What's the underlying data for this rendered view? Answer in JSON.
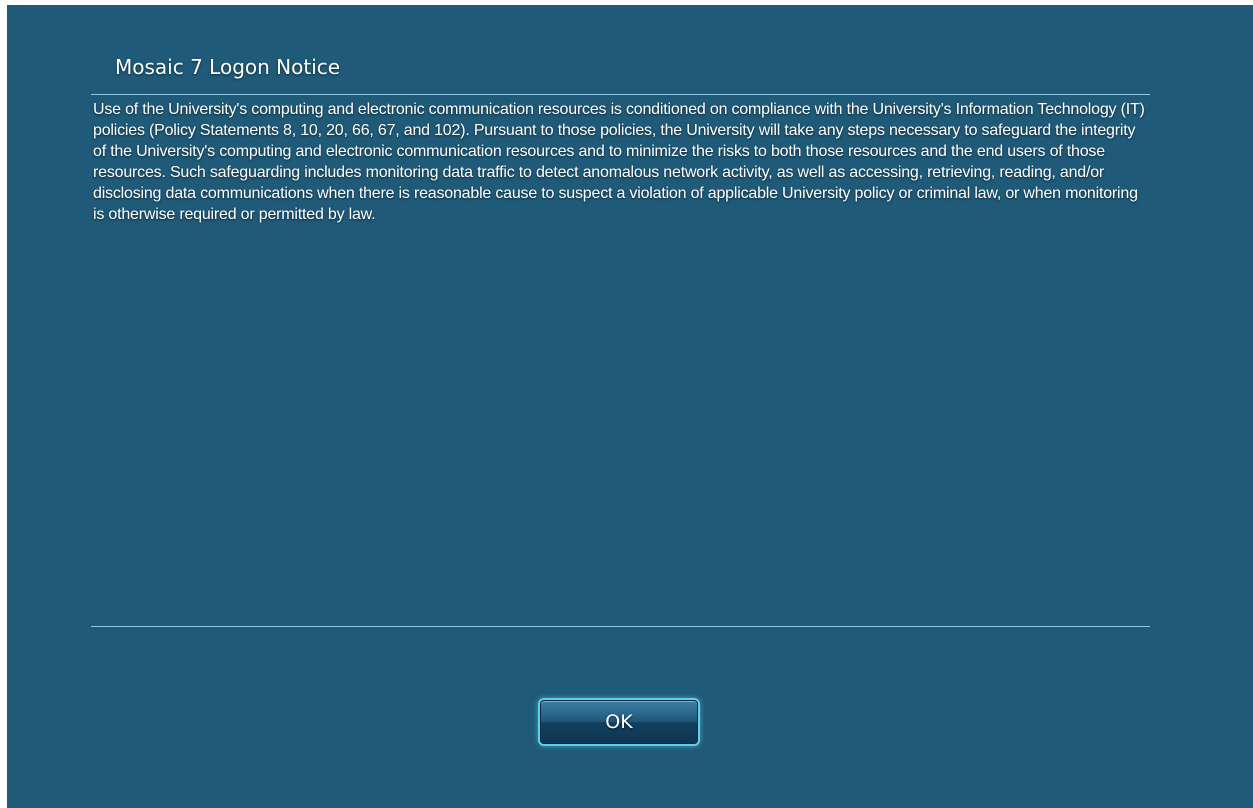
{
  "dialog": {
    "title": "Mosaic 7 Logon Notice",
    "message": "Use of the University's computing and electronic communication resources is conditioned on compliance with the University's Information Technology (IT) policies (Policy Statements 8, 10, 20, 66, 67, and 102).  Pursuant to those policies, the University will take any steps necessary to safeguard the integrity of the University's computing and electronic communication resources and to minimize the risks to both those resources and the end users of those resources. Such safeguarding includes monitoring data traffic to detect anomalous network activity, as well as accessing, retrieving, reading, and/or disclosing data communications when there is reasonable cause to suspect a violation of applicable University policy or criminal law, or when monitoring is otherwise required or permitted by law.",
    "ok_label": "OK"
  },
  "colors": {
    "background": "#1f5a78",
    "rule": "#8ec7e3",
    "button_glow": "#5ed0ec"
  }
}
